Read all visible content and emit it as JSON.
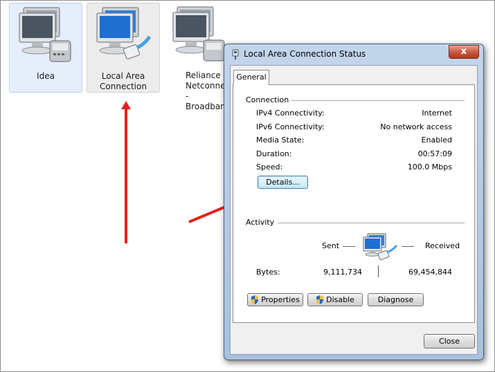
{
  "adapters": [
    {
      "label": "Idea"
    },
    {
      "label_line1": "Local Area",
      "label_line2": "Connection"
    },
    {
      "label_line1": "Reliance",
      "label_line2": "Netconnect -",
      "label_line3": "Broadband+"
    }
  ],
  "dialog": {
    "title": "Local Area Connection Status",
    "close_glyph": "x",
    "tab_general": "General",
    "connection": {
      "heading": "Connection",
      "rows": [
        {
          "label": "IPv4 Connectivity:",
          "value": "Internet"
        },
        {
          "label": "IPv6 Connectivity:",
          "value": "No network access"
        },
        {
          "label": "Media State:",
          "value": "Enabled"
        },
        {
          "label": "Duration:",
          "value": "00:57:09"
        },
        {
          "label": "Speed:",
          "value": "100.0 Mbps"
        }
      ],
      "details_button": "Details..."
    },
    "activity": {
      "heading": "Activity",
      "sent_label": "Sent",
      "received_label": "Received",
      "bytes_label": "Bytes:",
      "bytes_sent": "9,111,734",
      "bytes_received": "69,454,844"
    },
    "buttons": {
      "properties": "Properties",
      "disable": "Disable",
      "diagnose": "Diagnose",
      "close": "Close"
    }
  },
  "colors": {
    "annotation_arrow": "#e8201a",
    "dialog_frame": "#b4c9e3",
    "close_button": "#c7563d"
  },
  "icons": [
    "network-adapter-icon",
    "network-status-icon",
    "shield-icon"
  ]
}
